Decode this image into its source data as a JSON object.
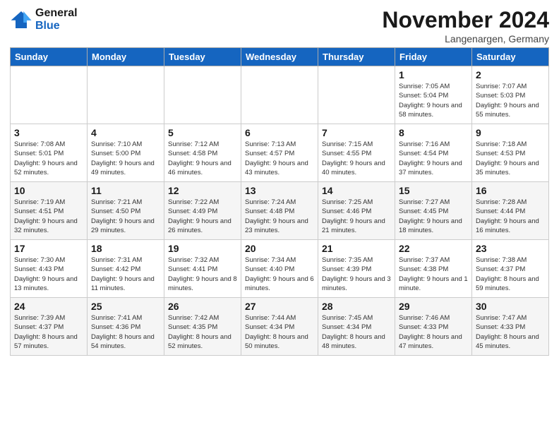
{
  "header": {
    "logo_line1": "General",
    "logo_line2": "Blue",
    "month": "November 2024",
    "location": "Langenargen, Germany"
  },
  "day_headers": [
    "Sunday",
    "Monday",
    "Tuesday",
    "Wednesday",
    "Thursday",
    "Friday",
    "Saturday"
  ],
  "weeks": [
    {
      "row_alt": false,
      "cells": [
        {
          "day": "",
          "text": ""
        },
        {
          "day": "",
          "text": ""
        },
        {
          "day": "",
          "text": ""
        },
        {
          "day": "",
          "text": ""
        },
        {
          "day": "",
          "text": ""
        },
        {
          "day": "1",
          "text": "Sunrise: 7:05 AM\nSunset: 5:04 PM\nDaylight: 9 hours\nand 58 minutes."
        },
        {
          "day": "2",
          "text": "Sunrise: 7:07 AM\nSunset: 5:03 PM\nDaylight: 9 hours\nand 55 minutes."
        }
      ]
    },
    {
      "row_alt": false,
      "cells": [
        {
          "day": "3",
          "text": "Sunrise: 7:08 AM\nSunset: 5:01 PM\nDaylight: 9 hours\nand 52 minutes."
        },
        {
          "day": "4",
          "text": "Sunrise: 7:10 AM\nSunset: 5:00 PM\nDaylight: 9 hours\nand 49 minutes."
        },
        {
          "day": "5",
          "text": "Sunrise: 7:12 AM\nSunset: 4:58 PM\nDaylight: 9 hours\nand 46 minutes."
        },
        {
          "day": "6",
          "text": "Sunrise: 7:13 AM\nSunset: 4:57 PM\nDaylight: 9 hours\nand 43 minutes."
        },
        {
          "day": "7",
          "text": "Sunrise: 7:15 AM\nSunset: 4:55 PM\nDaylight: 9 hours\nand 40 minutes."
        },
        {
          "day": "8",
          "text": "Sunrise: 7:16 AM\nSunset: 4:54 PM\nDaylight: 9 hours\nand 37 minutes."
        },
        {
          "day": "9",
          "text": "Sunrise: 7:18 AM\nSunset: 4:53 PM\nDaylight: 9 hours\nand 35 minutes."
        }
      ]
    },
    {
      "row_alt": true,
      "cells": [
        {
          "day": "10",
          "text": "Sunrise: 7:19 AM\nSunset: 4:51 PM\nDaylight: 9 hours\nand 32 minutes."
        },
        {
          "day": "11",
          "text": "Sunrise: 7:21 AM\nSunset: 4:50 PM\nDaylight: 9 hours\nand 29 minutes."
        },
        {
          "day": "12",
          "text": "Sunrise: 7:22 AM\nSunset: 4:49 PM\nDaylight: 9 hours\nand 26 minutes."
        },
        {
          "day": "13",
          "text": "Sunrise: 7:24 AM\nSunset: 4:48 PM\nDaylight: 9 hours\nand 23 minutes."
        },
        {
          "day": "14",
          "text": "Sunrise: 7:25 AM\nSunset: 4:46 PM\nDaylight: 9 hours\nand 21 minutes."
        },
        {
          "day": "15",
          "text": "Sunrise: 7:27 AM\nSunset: 4:45 PM\nDaylight: 9 hours\nand 18 minutes."
        },
        {
          "day": "16",
          "text": "Sunrise: 7:28 AM\nSunset: 4:44 PM\nDaylight: 9 hours\nand 16 minutes."
        }
      ]
    },
    {
      "row_alt": false,
      "cells": [
        {
          "day": "17",
          "text": "Sunrise: 7:30 AM\nSunset: 4:43 PM\nDaylight: 9 hours\nand 13 minutes."
        },
        {
          "day": "18",
          "text": "Sunrise: 7:31 AM\nSunset: 4:42 PM\nDaylight: 9 hours\nand 11 minutes."
        },
        {
          "day": "19",
          "text": "Sunrise: 7:32 AM\nSunset: 4:41 PM\nDaylight: 9 hours\nand 8 minutes."
        },
        {
          "day": "20",
          "text": "Sunrise: 7:34 AM\nSunset: 4:40 PM\nDaylight: 9 hours\nand 6 minutes."
        },
        {
          "day": "21",
          "text": "Sunrise: 7:35 AM\nSunset: 4:39 PM\nDaylight: 9 hours\nand 3 minutes."
        },
        {
          "day": "22",
          "text": "Sunrise: 7:37 AM\nSunset: 4:38 PM\nDaylight: 9 hours\nand 1 minute."
        },
        {
          "day": "23",
          "text": "Sunrise: 7:38 AM\nSunset: 4:37 PM\nDaylight: 8 hours\nand 59 minutes."
        }
      ]
    },
    {
      "row_alt": true,
      "cells": [
        {
          "day": "24",
          "text": "Sunrise: 7:39 AM\nSunset: 4:37 PM\nDaylight: 8 hours\nand 57 minutes."
        },
        {
          "day": "25",
          "text": "Sunrise: 7:41 AM\nSunset: 4:36 PM\nDaylight: 8 hours\nand 54 minutes."
        },
        {
          "day": "26",
          "text": "Sunrise: 7:42 AM\nSunset: 4:35 PM\nDaylight: 8 hours\nand 52 minutes."
        },
        {
          "day": "27",
          "text": "Sunrise: 7:44 AM\nSunset: 4:34 PM\nDaylight: 8 hours\nand 50 minutes."
        },
        {
          "day": "28",
          "text": "Sunrise: 7:45 AM\nSunset: 4:34 PM\nDaylight: 8 hours\nand 48 minutes."
        },
        {
          "day": "29",
          "text": "Sunrise: 7:46 AM\nSunset: 4:33 PM\nDaylight: 8 hours\nand 47 minutes."
        },
        {
          "day": "30",
          "text": "Sunrise: 7:47 AM\nSunset: 4:33 PM\nDaylight: 8 hours\nand 45 minutes."
        }
      ]
    }
  ]
}
